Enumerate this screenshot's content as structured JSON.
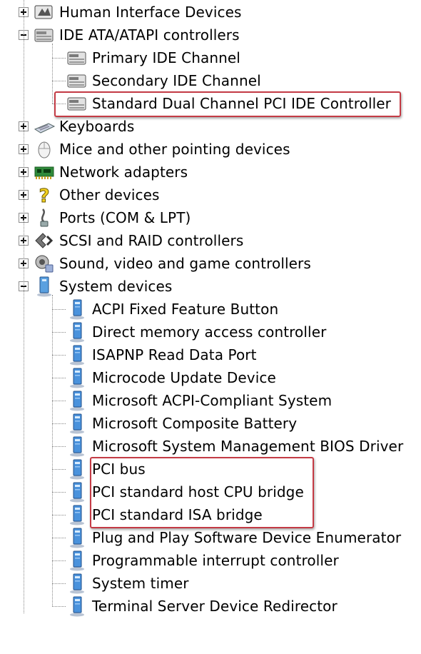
{
  "device_tree": {
    "categories": [
      {
        "label": "Human Interface Devices",
        "icon": "hid-device-icon",
        "expanded": false
      },
      {
        "label": "IDE ATA/ATAPI controllers",
        "icon": "ide-controller-icon",
        "expanded": true,
        "children": [
          "Primary IDE Channel",
          "Secondary IDE Channel",
          "Standard Dual Channel PCI IDE Controller"
        ]
      },
      {
        "label": "Keyboards",
        "icon": "keyboard-icon",
        "expanded": false
      },
      {
        "label": "Mice and other pointing devices",
        "icon": "mouse-icon",
        "expanded": false
      },
      {
        "label": "Network adapters",
        "icon": "network-adapter-icon",
        "expanded": false
      },
      {
        "label": "Other devices",
        "icon": "unknown-device-icon",
        "expanded": false
      },
      {
        "label": "Ports (COM & LPT)",
        "icon": "port-connector-icon",
        "expanded": false
      },
      {
        "label": "SCSI and RAID controllers",
        "icon": "scsi-controller-icon",
        "expanded": false
      },
      {
        "label": "Sound, video and game controllers",
        "icon": "sound-speaker-icon",
        "expanded": false
      },
      {
        "label": "System devices",
        "icon": "system-device-icon",
        "expanded": true,
        "children": [
          "ACPI Fixed Feature Button",
          "Direct memory access controller",
          "ISAPNP Read Data Port",
          "Microcode Update Device",
          "Microsoft ACPI-Compliant System",
          "Microsoft Composite Battery",
          "Microsoft System Management BIOS Driver",
          "PCI bus",
          "PCI standard host CPU bridge",
          "PCI standard ISA bridge",
          "Plug and Play Software Device Enumerator",
          "Programmable interrupt controller",
          "System timer",
          "Terminal Server Device Redirector"
        ]
      }
    ]
  },
  "highlight_color": "#c43b45"
}
